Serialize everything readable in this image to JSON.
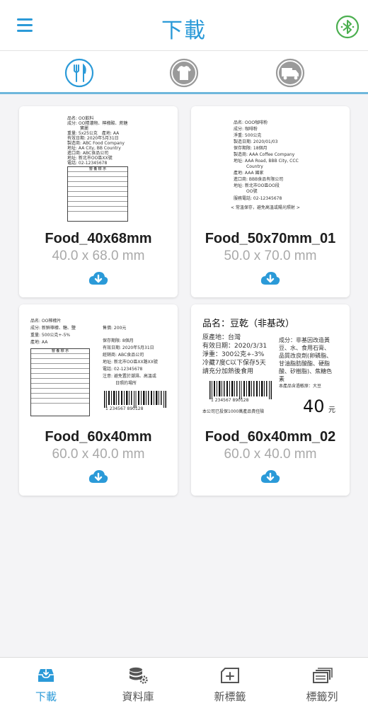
{
  "header": {
    "title": "下載"
  },
  "colors": {
    "accent": "#2b9ad8",
    "bluetooth": "#4caf50"
  },
  "categories": [
    {
      "icon": "food-icon",
      "active": true
    },
    {
      "icon": "clothing-icon",
      "active": false
    },
    {
      "icon": "truck-icon",
      "active": false
    }
  ],
  "templates": [
    {
      "name": "Food_40x68mm",
      "size": "40.0 x 68.0 mm",
      "label": {
        "lines": [
          "品名: OO飲料",
          "成分: OO精濃物、檸檬酸、蔗糖",
          "　　　寶麗",
          "重量: 5x25公克　產地: AA",
          "有效日期: 2020年5月31日",
          "製造商: ABC Food Company",
          "地址: AA City, BB Country",
          "進口商: ABC食品公司",
          "地址: 新北市OO區XX號",
          "電話: 02-12345678"
        ],
        "nutrition_title": "營 養 標 示"
      }
    },
    {
      "name": "Food_50x70mm_01",
      "size": "50.0 x 70.0 mm",
      "label": {
        "lines": [
          "品名: OOO咖啡粉",
          "成分: 咖啡粉",
          "淨重: 500公克",
          "製造日期: 2020/01/03",
          "保存期限: 18個月",
          "製造商: AAA Coffee Company",
          "地址: AAA Road, BBB City, CCC",
          "　　　Country",
          "產地: AAA 國家",
          "進口商: BBB食品有限公司",
          "地址: 新北市OO區OO段",
          "　　　OO號",
          "服務電話: 02-12345678",
          "< 常溫保存，避免高溫或陽光照射 >"
        ]
      }
    },
    {
      "name": "Food_60x40mm",
      "size": "60.0 x 40.0 mm",
      "label": {
        "left_lines": [
          "品名: OO檸檬片",
          "成分: 新鮮檸檬、糖、鹽",
          "重量: 500公克+-5%",
          "產地: AA"
        ],
        "nutrition_title": "營 養 標 示",
        "right_lines": [
          "售價: 200元",
          "保存期限: 8個月",
          "有效日期: 2020年5月31日",
          "經銷商: ABC食品公司",
          "地址: 新北市OO區XX路XX號",
          "電話: 02-12345678",
          "注意: 避免置於潮濕、高溫或",
          "　　　日照的場所"
        ],
        "barcode_number": "1 234567 890128"
      }
    },
    {
      "name": "Food_60x40mm_02",
      "size": "60.0 x 40.0 mm",
      "label": {
        "title": "品名：豆乾（非基改）",
        "left_lines": [
          "原產地：台灣",
          "有效日期：2020/3/31",
          "淨重：300公克+-3%",
          "冷藏7度C以下保存5天",
          "請充分加熱後食用"
        ],
        "right_lines": [
          "成分：非基因改造黃",
          "豆、水、食用石膏、",
          "品質改良劑(卵磷脂、",
          "甘油脂肪酸酯、硬脂",
          "酸、矽樹脂)、焦糖色",
          "素",
          "本產品含過敏原：大豆"
        ],
        "barcode_number": "1 234567 890128",
        "insurance": "本公司已投保1000萬產品責任險",
        "price": "40",
        "price_unit": "元"
      }
    }
  ],
  "bottom_nav": [
    {
      "label": "下載",
      "icon": "download-tray-icon",
      "active": true
    },
    {
      "label": "資料庫",
      "icon": "database-gear-icon",
      "active": false
    },
    {
      "label": "新標籤",
      "icon": "new-label-icon",
      "active": false
    },
    {
      "label": "標籤列",
      "icon": "label-list-icon",
      "active": false
    }
  ]
}
